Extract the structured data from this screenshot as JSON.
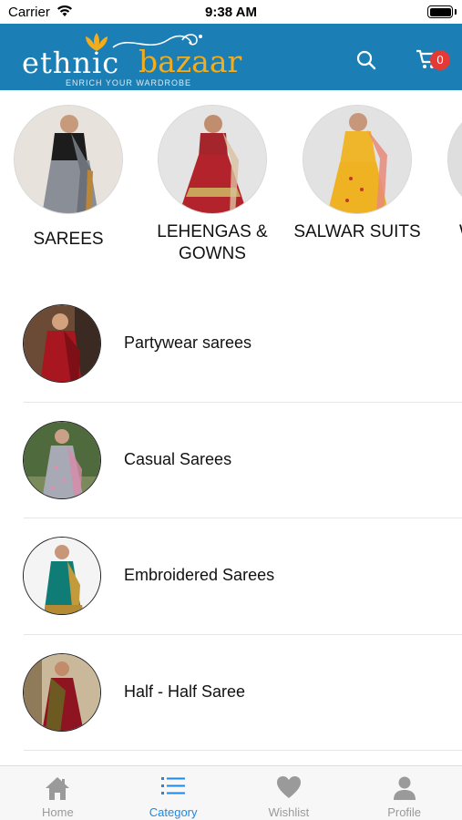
{
  "status_bar": {
    "carrier": "Carrier",
    "time": "9:38 AM"
  },
  "header": {
    "logo_word_1": "ethnic",
    "logo_word_2": "bazaar",
    "tagline": "ENRICH YOUR WARDROBE",
    "cart_count": "0",
    "colors": {
      "background": "#1b7fb5",
      "accent": "#f3ad1c",
      "badge": "#e53935"
    }
  },
  "featured": [
    {
      "label": "SAREES",
      "icon": "saree-photo"
    },
    {
      "label": "LEHENGAS & GOWNS",
      "icon": "lehenga-photo"
    },
    {
      "label": "SALWAR SUITS",
      "icon": "salwar-photo"
    },
    {
      "label": "W",
      "icon": "partial-category-photo"
    }
  ],
  "subcategories": [
    {
      "label": "Partywear sarees",
      "icon": "red-saree-photo"
    },
    {
      "label": "Casual Sarees",
      "icon": "grey-saree-photo"
    },
    {
      "label": "Embroidered Sarees",
      "icon": "teal-saree-photo"
    },
    {
      "label": "Half - Half Saree",
      "icon": "maroon-saree-photo"
    }
  ],
  "tabs": [
    {
      "label": "Home",
      "icon": "home-icon",
      "active": false
    },
    {
      "label": "Category",
      "icon": "list-icon",
      "active": true
    },
    {
      "label": "Wishlist",
      "icon": "heart-icon",
      "active": false
    },
    {
      "label": "Profile",
      "icon": "person-icon",
      "active": false
    }
  ]
}
